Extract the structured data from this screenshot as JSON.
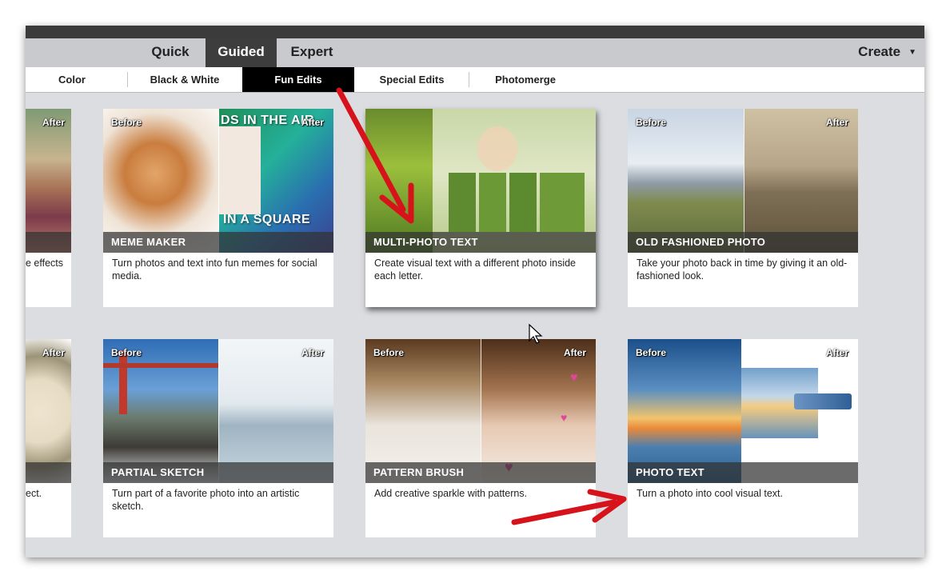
{
  "mode_tabs": [
    {
      "label": "Quick",
      "active": false
    },
    {
      "label": "Guided",
      "active": true
    },
    {
      "label": "Expert",
      "active": false
    }
  ],
  "create_label": "Create",
  "sub_tabs": [
    {
      "label": "Color",
      "active": false
    },
    {
      "label": "Black & White",
      "active": false
    },
    {
      "label": "Fun Edits",
      "active": true
    },
    {
      "label": "Special Edits",
      "active": false
    },
    {
      "label": "Photomerge",
      "active": false
    }
  ],
  "before_label": "Before",
  "after_label": "After",
  "partial_cards": [
    {
      "description": "e effects"
    },
    {
      "description": "ect."
    }
  ],
  "cards": [
    {
      "title": "MEME MAKER",
      "description": "Turn photos and text into fun memes for social media.",
      "overlay_top": "DS IN THE AIR",
      "overlay_bottom": "IN A SQUARE"
    },
    {
      "title": "MULTI-PHOTO TEXT",
      "description": "Create visual text with a different photo inside each letter."
    },
    {
      "title": "OLD FASHIONED PHOTO",
      "description": "Take your photo back in time by giving it an old-fashioned look."
    },
    {
      "title": "PARTIAL SKETCH",
      "description": "Turn part of a favorite photo into an artistic sketch."
    },
    {
      "title": "PATTERN BRUSH",
      "description": "Add creative sparkle with patterns."
    },
    {
      "title": "PHOTO TEXT",
      "description": "Turn a photo into cool visual text."
    }
  ],
  "colors": {
    "arrow": "#d6121b",
    "active_mode": "#3d3d3d",
    "active_sub": "#000000"
  }
}
